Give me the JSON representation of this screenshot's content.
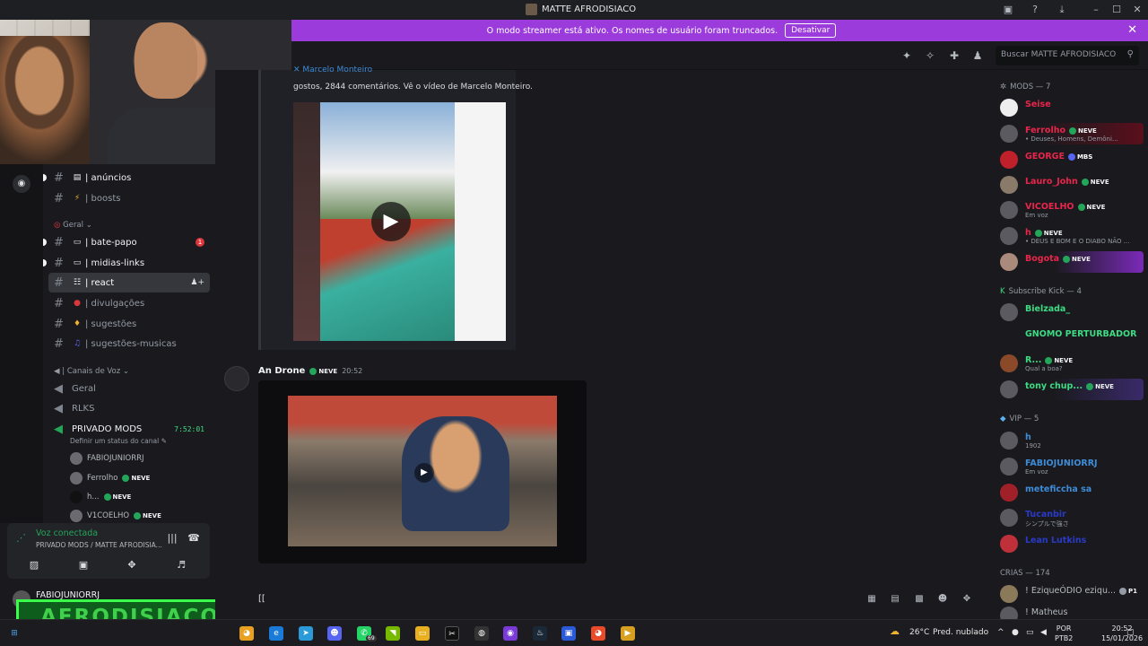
{
  "window": {
    "title": "MATTE AFRODISIACO"
  },
  "banner": {
    "text": "O modo streamer está ativo. Os nomes de usuário foram truncados.",
    "button": "Desativar"
  },
  "search": {
    "placeholder": "Buscar MATTE AFRODISIACO"
  },
  "channels": {
    "anuncios": "| anúncios",
    "boosts": "| boosts",
    "cat_geral": "Geral",
    "bate_papo": "| bate-papo",
    "bate_papo_badge": "1",
    "midias": "| midias-links",
    "react": "| react",
    "divulgacoes": "| divulgações",
    "sugestoes": "| sugestões",
    "sugestoes_musicas": "| sugestões-musicas",
    "cat_voz": "| Canais de Voz",
    "voz_geral": "Geral",
    "rlks": "RLKS",
    "privado": "PRIVADO MODS",
    "privado_time": "7:52:01",
    "privado_status": "Definir um status do canal",
    "voice_users": [
      {
        "name": "FABIOJUNIORRJ",
        "neve": false
      },
      {
        "name": "Ferrolho",
        "neve": true
      },
      {
        "name": "h...",
        "neve": true
      },
      {
        "name": "V1COELHO",
        "neve": true
      }
    ]
  },
  "voice_panel": {
    "status": "Voz conectada",
    "sub": "PRIVADO MODS / MATTE AFRODISIA..."
  },
  "user_panel": {
    "name": "FABIOJUNIORRJ"
  },
  "overlay": {
    "text": "AFRODISIACO"
  },
  "neve_label": "NEVE",
  "messages": {
    "embed_author": "Marcelo Monteiro",
    "embed_text": "gostos, 2844 comentários. Vê o vídeo de Marcelo Monteiro.",
    "msg2_author": "An Drone",
    "msg2_time": "20:52"
  },
  "composer": {
    "text": "[["
  },
  "members": {
    "mods_header": "MODS — 7",
    "mods": [
      {
        "name": "Seise",
        "color": "#e8254a",
        "neve": false,
        "status": ""
      },
      {
        "name": "Ferrolho",
        "color": "#e8254a",
        "neve": true,
        "status": "• Deuses, Homens, Demôni..."
      },
      {
        "name": "GEORGE",
        "color": "#e8254a",
        "neve": false,
        "badge": "MBS",
        "status": ""
      },
      {
        "name": "Lauro_John",
        "color": "#e8254a",
        "neve": true,
        "status": ""
      },
      {
        "name": "VICOELHO",
        "color": "#e8254a",
        "neve": true,
        "status": "Em voz"
      },
      {
        "name": "h",
        "color": "#e8254a",
        "neve": true,
        "status": "• DEUS E BOM E O DIABO NÃO ..."
      },
      {
        "name": "Bogota",
        "color": "#e8254a",
        "neve": true,
        "status": ""
      }
    ],
    "kick_header": "Subscribe Kick — 4",
    "kick": [
      {
        "name": "Bielzada_",
        "color": "#3ddc84",
        "neve": false,
        "status": ""
      },
      {
        "name": "GNOMO PERTURBADOR",
        "color": "#3ddc84",
        "neve": false,
        "status": ""
      },
      {
        "name": "R...",
        "color": "#3ddc84",
        "neve": true,
        "status": "Qual a boa?"
      },
      {
        "name": "tony chup...",
        "color": "#3ddc84",
        "neve": true,
        "status": ""
      }
    ],
    "vip_header": "VIP — 5",
    "vip": [
      {
        "name": "h",
        "color": "#3e8cd8",
        "neve": false,
        "status": "1902"
      },
      {
        "name": "FABIOJUNIORRJ",
        "color": "#3e8cd8",
        "neve": false,
        "status": "Em voz"
      },
      {
        "name": "meteficcha sa",
        "color": "#3e8cd8",
        "neve": false,
        "status": ""
      },
      {
        "name": "Tucanbir",
        "color": "#3e8cd8",
        "neve": false,
        "status": "シンプルで強さ"
      },
      {
        "name": "Lean Lutkins",
        "color": "#3e8cd8",
        "neve": false,
        "status": ""
      }
    ],
    "crias_header": "CRIAS — 174",
    "crias": [
      {
        "name": "! EziqueÓDIO eziqu...",
        "color": "#b5bac1",
        "badge": "P1"
      },
      {
        "name": "! Matheus",
        "color": "#b5bac1"
      }
    ]
  },
  "taskbar": {
    "weather": "26°C",
    "weather_desc": "Pred. nublado",
    "lang1": "POR",
    "lang2": "PTB2",
    "time": "20:52",
    "date": "15/01/2026",
    "whatsapp_badge": "69"
  }
}
